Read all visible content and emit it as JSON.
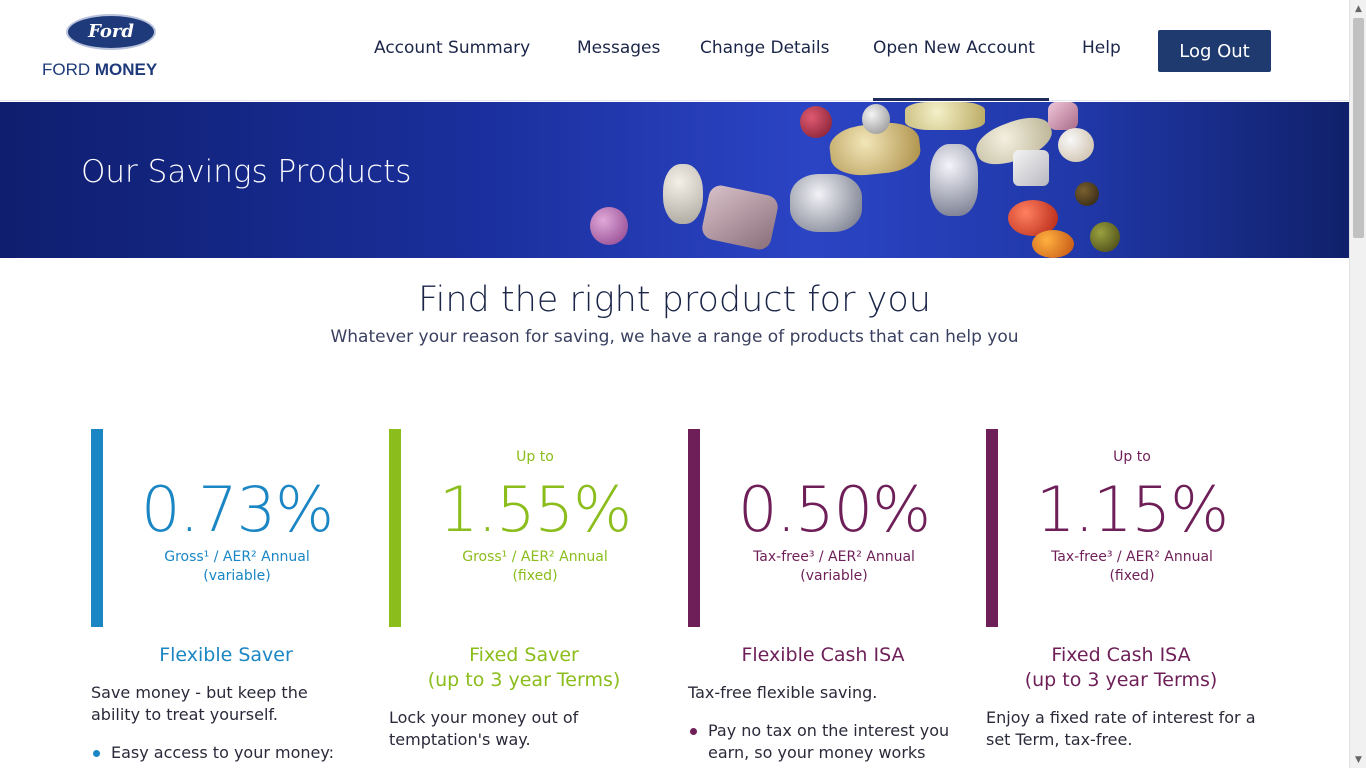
{
  "header": {
    "logo_oval": "Ford",
    "logo_brand_light": "FORD ",
    "logo_brand_bold": "MONEY",
    "nav": [
      "Account Summary",
      "Messages",
      "Change Details",
      "Open New Account",
      "Help"
    ],
    "active_nav": "Open New Account",
    "logout_label": "Log Out"
  },
  "hero": {
    "title": "Our Savings Products"
  },
  "intro": {
    "heading": "Find the right product for you",
    "subheading": "Whatever your reason for saving, we have a range of products that can help you"
  },
  "products": [
    {
      "accent": "#1a86c4",
      "upto": "",
      "rate": "0.73%",
      "desc1": "Gross¹ / AER² Annual",
      "desc2": "(variable)",
      "name1": "Flexible Saver",
      "name2": "",
      "text": "Save money - but keep the ability to treat yourself.",
      "bullet": "Easy access to your money:"
    },
    {
      "accent": "#8bbd1c",
      "upto": "Up to",
      "rate": "1.55%",
      "desc1": "Gross¹ / AER² Annual",
      "desc2": "(fixed)",
      "name1": "Fixed Saver",
      "name2": "(up to 3 year Terms)",
      "text": "Lock your money out of temptation's way.",
      "bullet": ""
    },
    {
      "accent": "#6e1f58",
      "upto": "",
      "rate": "0.50%",
      "desc1": "Tax-free³ / AER² Annual",
      "desc2": "(variable)",
      "name1": "Flexible Cash ISA",
      "name2": "",
      "text": "Tax-free flexible saving.",
      "bullet": "Pay no tax on the interest you earn, so your money works even"
    },
    {
      "accent": "#6e1f58",
      "upto": "Up to",
      "rate": "1.15%",
      "desc1": "Tax-free³ / AER² Annual",
      "desc2": "(fixed)",
      "name1": "Fixed Cash ISA",
      "name2": "(up to 3 year Terms)",
      "text": "Enjoy a fixed rate of interest for a set Term, tax-free.",
      "bullet": ""
    }
  ],
  "scrollbar": {
    "up_icon": "triangle-up-icon",
    "down_icon": "triangle-down-icon"
  }
}
